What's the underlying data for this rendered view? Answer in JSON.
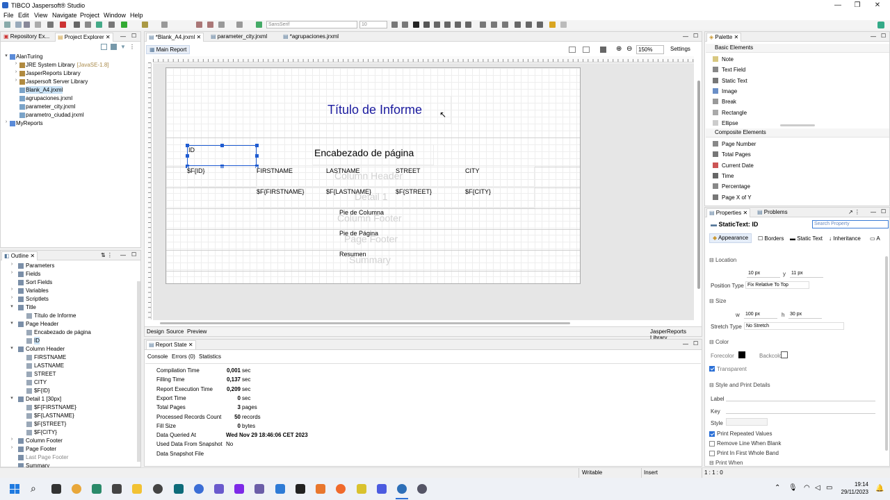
{
  "app": {
    "title": "TIBCO Jaspersoft® Studio"
  },
  "menu": [
    "File",
    "Edit",
    "View",
    "Navigate",
    "Project",
    "Window",
    "Help"
  ],
  "toolbar": {
    "font": "SansSerif",
    "size": "10"
  },
  "left_panel": {
    "tabs": [
      "Repository Ex...",
      "Project Explorer"
    ],
    "tree": [
      {
        "label": "AlanTuring",
        "extra": "",
        "level": 0,
        "tw": "▾"
      },
      {
        "label": "JRE System Library",
        "extra": "[JavaSE-1.8]",
        "level": 1,
        "tw": "›"
      },
      {
        "label": "JasperReports Library",
        "extra": "",
        "level": 1,
        "tw": "›"
      },
      {
        "label": "Jaspersoft Server Library",
        "extra": "",
        "level": 1,
        "tw": "›"
      },
      {
        "label": "Blank_A4.jrxml",
        "extra": "",
        "level": 1,
        "tw": ""
      },
      {
        "label": "agrupaciones.jrxml",
        "extra": "",
        "level": 1,
        "tw": ""
      },
      {
        "label": "parameter_city.jrxml",
        "extra": "",
        "level": 1,
        "tw": ""
      },
      {
        "label": "parametro_ciudad.jrxml",
        "extra": "",
        "level": 1,
        "tw": ""
      },
      {
        "label": "MyReports",
        "extra": "",
        "level": 0,
        "tw": "›"
      }
    ]
  },
  "outline": {
    "tab": "Outline",
    "items": [
      {
        "label": "Parameters",
        "level": 1,
        "tw": "›"
      },
      {
        "label": "Fields",
        "level": 1,
        "tw": "›"
      },
      {
        "label": "Sort Fields",
        "level": 1,
        "tw": ""
      },
      {
        "label": "Variables",
        "level": 1,
        "tw": "›"
      },
      {
        "label": "Scriptlets",
        "level": 1,
        "tw": "›"
      },
      {
        "label": "Title",
        "level": 1,
        "tw": "▾"
      },
      {
        "label": "Título de Informe",
        "level": 2,
        "tw": ""
      },
      {
        "label": "Page Header",
        "level": 1,
        "tw": "▾"
      },
      {
        "label": "Encabezado de página",
        "level": 2,
        "tw": ""
      },
      {
        "label": "ID",
        "level": 2,
        "tw": ""
      },
      {
        "label": "Column Header",
        "level": 1,
        "tw": "▾"
      },
      {
        "label": "FIRSTNAME",
        "level": 2,
        "tw": ""
      },
      {
        "label": "LASTNAME",
        "level": 2,
        "tw": ""
      },
      {
        "label": "STREET",
        "level": 2,
        "tw": ""
      },
      {
        "label": "CITY",
        "level": 2,
        "tw": ""
      },
      {
        "label": "$F{ID}",
        "level": 2,
        "tw": ""
      },
      {
        "label": "Detail 1 [30px]",
        "level": 1,
        "tw": "▾"
      },
      {
        "label": "$F{FIRSTNAME}",
        "level": 2,
        "tw": ""
      },
      {
        "label": "$F{LASTNAME}",
        "level": 2,
        "tw": ""
      },
      {
        "label": "$F{STREET}",
        "level": 2,
        "tw": ""
      },
      {
        "label": "$F{CITY}",
        "level": 2,
        "tw": ""
      },
      {
        "label": "Column Footer",
        "level": 1,
        "tw": "›"
      },
      {
        "label": "Page Footer",
        "level": 1,
        "tw": "›"
      },
      {
        "label": "Last Page Footer",
        "level": 1,
        "tw": ""
      },
      {
        "label": "Summary",
        "level": 1,
        "tw": ""
      }
    ]
  },
  "editor": {
    "tabs": [
      "*Blank_A4.jrxml",
      "parameter_city.jrxml",
      "*agrupaciones.jrxml"
    ],
    "subtab": "Main Report",
    "zoom": "150%",
    "settings": "Settings",
    "bottom_tabs": [
      "Design",
      "Source",
      "Preview"
    ],
    "library": "JasperReports Library",
    "report": {
      "title": "Título de Informe",
      "page_header": "Encabezado de página",
      "id_label": "ID",
      "id_field": "$F{ID}",
      "col_headers": [
        "FIRSTNAME",
        "LASTNAME",
        "STREET",
        "CITY"
      ],
      "details": [
        "$F{FIRSTNAME}",
        "$F{LASTNAME}",
        "$F{STREET}",
        "$F{CITY}"
      ],
      "ghost_column_header": "Column Header",
      "ghost_detail": "Detail 1",
      "ghost_column_footer": "Column Footer",
      "ghost_page_footer": "Page Footer",
      "ghost_summary": "Summary",
      "pie_columna": "Pie de Columna",
      "pie_pagina": "Pie de Página",
      "resumen": "Resumen"
    }
  },
  "report_state": {
    "tab": "Report State",
    "subtabs": [
      "Console",
      "Errors (0)",
      "Statistics"
    ],
    "rows": [
      {
        "label": "Compilation Time",
        "value": "0,001",
        "unit": "sec"
      },
      {
        "label": "Filling Time",
        "value": "0,137",
        "unit": "sec"
      },
      {
        "label": "Report Execution Time",
        "value": "0,209",
        "unit": "sec"
      },
      {
        "label": "Export Time",
        "value": "0",
        "unit": "sec"
      },
      {
        "label": "Total Pages",
        "value": "3",
        "unit": "pages"
      },
      {
        "label": "Processed Records Count",
        "value": "50",
        "unit": "records"
      },
      {
        "label": "Fill Size",
        "value": "0",
        "unit": "bytes"
      },
      {
        "label": "Data Queried At",
        "value": "Wed Nov 29 18:46:06 CET 2023",
        "unit": ""
      },
      {
        "label": "Used Data From Snapshot",
        "value": "No",
        "unit": ""
      },
      {
        "label": "Data Snapshot File",
        "value": "",
        "unit": ""
      }
    ]
  },
  "palette": {
    "tab": "Palette",
    "basic_title": "Basic Elements",
    "basic": [
      "Note",
      "Text Field",
      "Static Text",
      "Image",
      "Break",
      "Rectangle",
      "Ellipse"
    ],
    "composite_title": "Composite Elements",
    "composite": [
      "Page Number",
      "Total Pages",
      "Current Date",
      "Time",
      "Percentage",
      "Page X of Y"
    ]
  },
  "properties": {
    "tabs": [
      "Properties",
      "Problems"
    ],
    "heading": "StaticText: ID",
    "search_placeholder": "Search Property",
    "subtabs": [
      "Appearance",
      "Borders",
      "Static Text",
      "Inheritance",
      "A"
    ],
    "location_title": "Location",
    "x": "10 px",
    "y": "11 px",
    "position_type_label": "Position Type",
    "position_type": "Fix Relative To Top",
    "size_title": "Size",
    "w": "100 px",
    "h": "30 px",
    "stretch_type_label": "Stretch Type",
    "stretch_type": "No Stretch",
    "color_title": "Color",
    "forecolor": "Forecolor",
    "backcolor": "Backcolor",
    "transparent": "Transparent",
    "style_title": "Style and Print Details",
    "label": "Label",
    "key": "Key",
    "style": "Style",
    "print_repeated": "Print Repeated Values",
    "remove_line": "Remove Line When Blank",
    "print_first": "Print In First Whole Band",
    "print_when": "Print When"
  },
  "status": {
    "mode": "Writable",
    "insert": "Insert",
    "pos": "1 : 1 : 0"
  },
  "taskbar": {
    "time": "19:14",
    "date": "29/11/2023"
  },
  "colors": {
    "title_blue": "#1a1a9e",
    "accent": "#1e5bd1"
  }
}
